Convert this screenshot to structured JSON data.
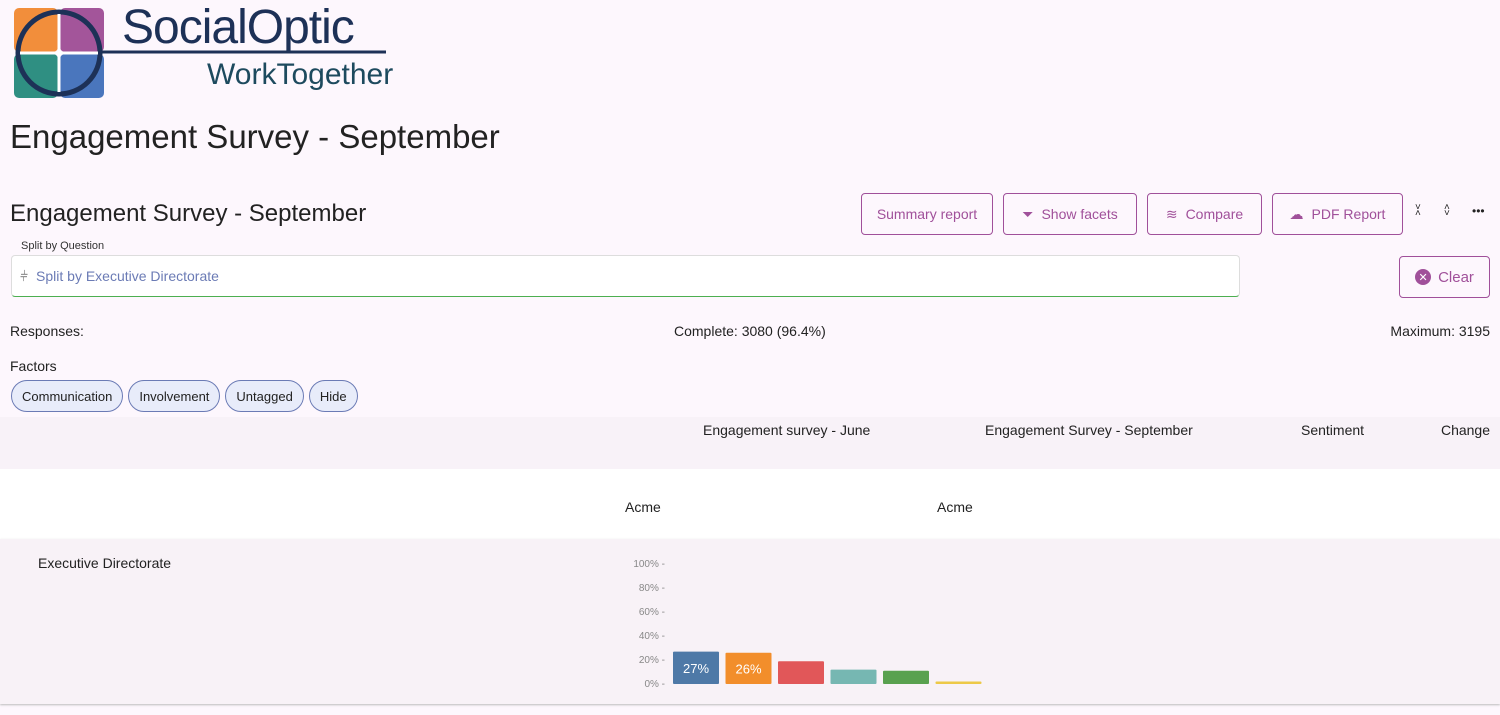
{
  "logo": {
    "brand": "SocialOptic",
    "tagline": "WorkTogether"
  },
  "page_title": "Engagement Survey - September",
  "survey_title": "Engagement Survey - September",
  "toolbar": {
    "summary": "Summary report",
    "facets": "Show facets",
    "compare": "Compare",
    "pdf": "PDF Report"
  },
  "split": {
    "label": "Split by Question",
    "value": "Split by Executive Directorate",
    "clear": "Clear"
  },
  "responses": {
    "label": "Responses:",
    "complete": "Complete: 3080 (96.4%)",
    "maximum": "Maximum: 3195"
  },
  "factors": {
    "label": "Factors",
    "chips": [
      "Communication",
      "Involvement",
      "Untagged",
      "Hide"
    ]
  },
  "table": {
    "headers": [
      "Engagement survey - June",
      "Engagement Survey - September",
      "Sentiment",
      "Change"
    ],
    "sub": [
      "Acme",
      "Acme"
    ],
    "row_label": "Executive Directorate"
  },
  "chart_data": {
    "type": "bar",
    "yticks": [
      "100%",
      "80%",
      "60%",
      "40%",
      "20%",
      "0%"
    ],
    "ylim": [
      0,
      100
    ],
    "values": [
      27,
      26,
      19,
      12,
      11,
      1
    ],
    "labels": [
      "27%",
      "26%",
      "",
      "",
      "",
      ""
    ],
    "colors": [
      "#4e79a7",
      "#f28e2b",
      "#e15759",
      "#76b7b2",
      "#59a14f",
      "#edc948"
    ]
  },
  "colors": {
    "accent": "#a0509a"
  }
}
